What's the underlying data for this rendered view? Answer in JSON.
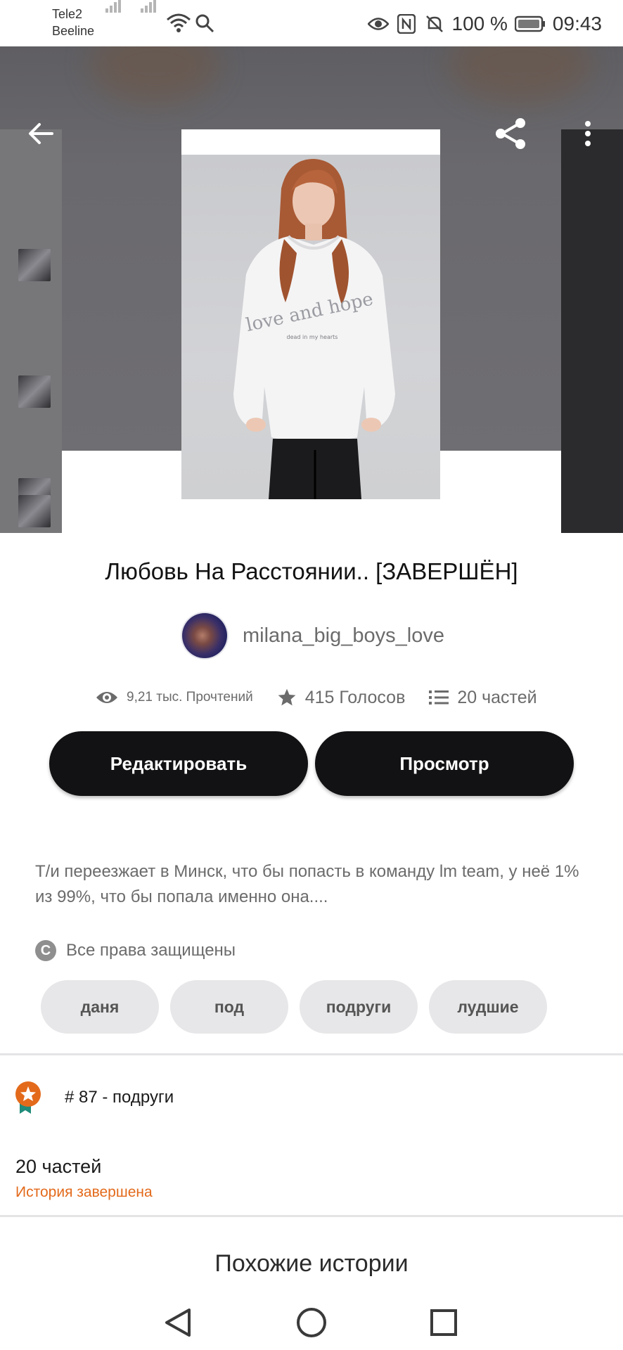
{
  "status_bar": {
    "carrier_1": "Tele2",
    "carrier_2": "Beeline",
    "battery": "100 %",
    "time": "09:43",
    "icons": [
      "signal-icon",
      "signal-icon",
      "wifi-icon",
      "search-icon",
      "eye-icon",
      "nfc-icon",
      "mute-icon",
      "battery-icon"
    ]
  },
  "toolbar": {
    "back_icon": "arrow-left-icon",
    "share_icon": "share-icon",
    "more_icon": "more-vertical-icon"
  },
  "story": {
    "title": "Любовь На Расстоянии.. [ЗАВЕРШЁН]",
    "author": "milana_big_boys_love",
    "reads": "9,21 тыс. Прочтений",
    "votes": "415 Голосов",
    "parts": "20 частей",
    "description": "Т/и переезжает в Минск, что бы попасть в команду lm team, у неё 1% из 99%, что бы попала именно она....",
    "copyright": "Все права защищены",
    "copyright_symbol": "C"
  },
  "buttons": {
    "edit": "Редактировать",
    "view": "Просмотр"
  },
  "tags": [
    "даня",
    "под",
    "подруги",
    "лудшие"
  ],
  "ranking": {
    "text": "# 87 - подруги"
  },
  "parts_info": {
    "count": "20 частей",
    "status": "История завершена"
  },
  "similar": {
    "title": "Похожие истории"
  },
  "colors": {
    "button_bg": "#121214",
    "accent_orange": "#e36a1b",
    "tag_bg": "#e7e7e9",
    "badge_teal": "#1f8b7a"
  }
}
